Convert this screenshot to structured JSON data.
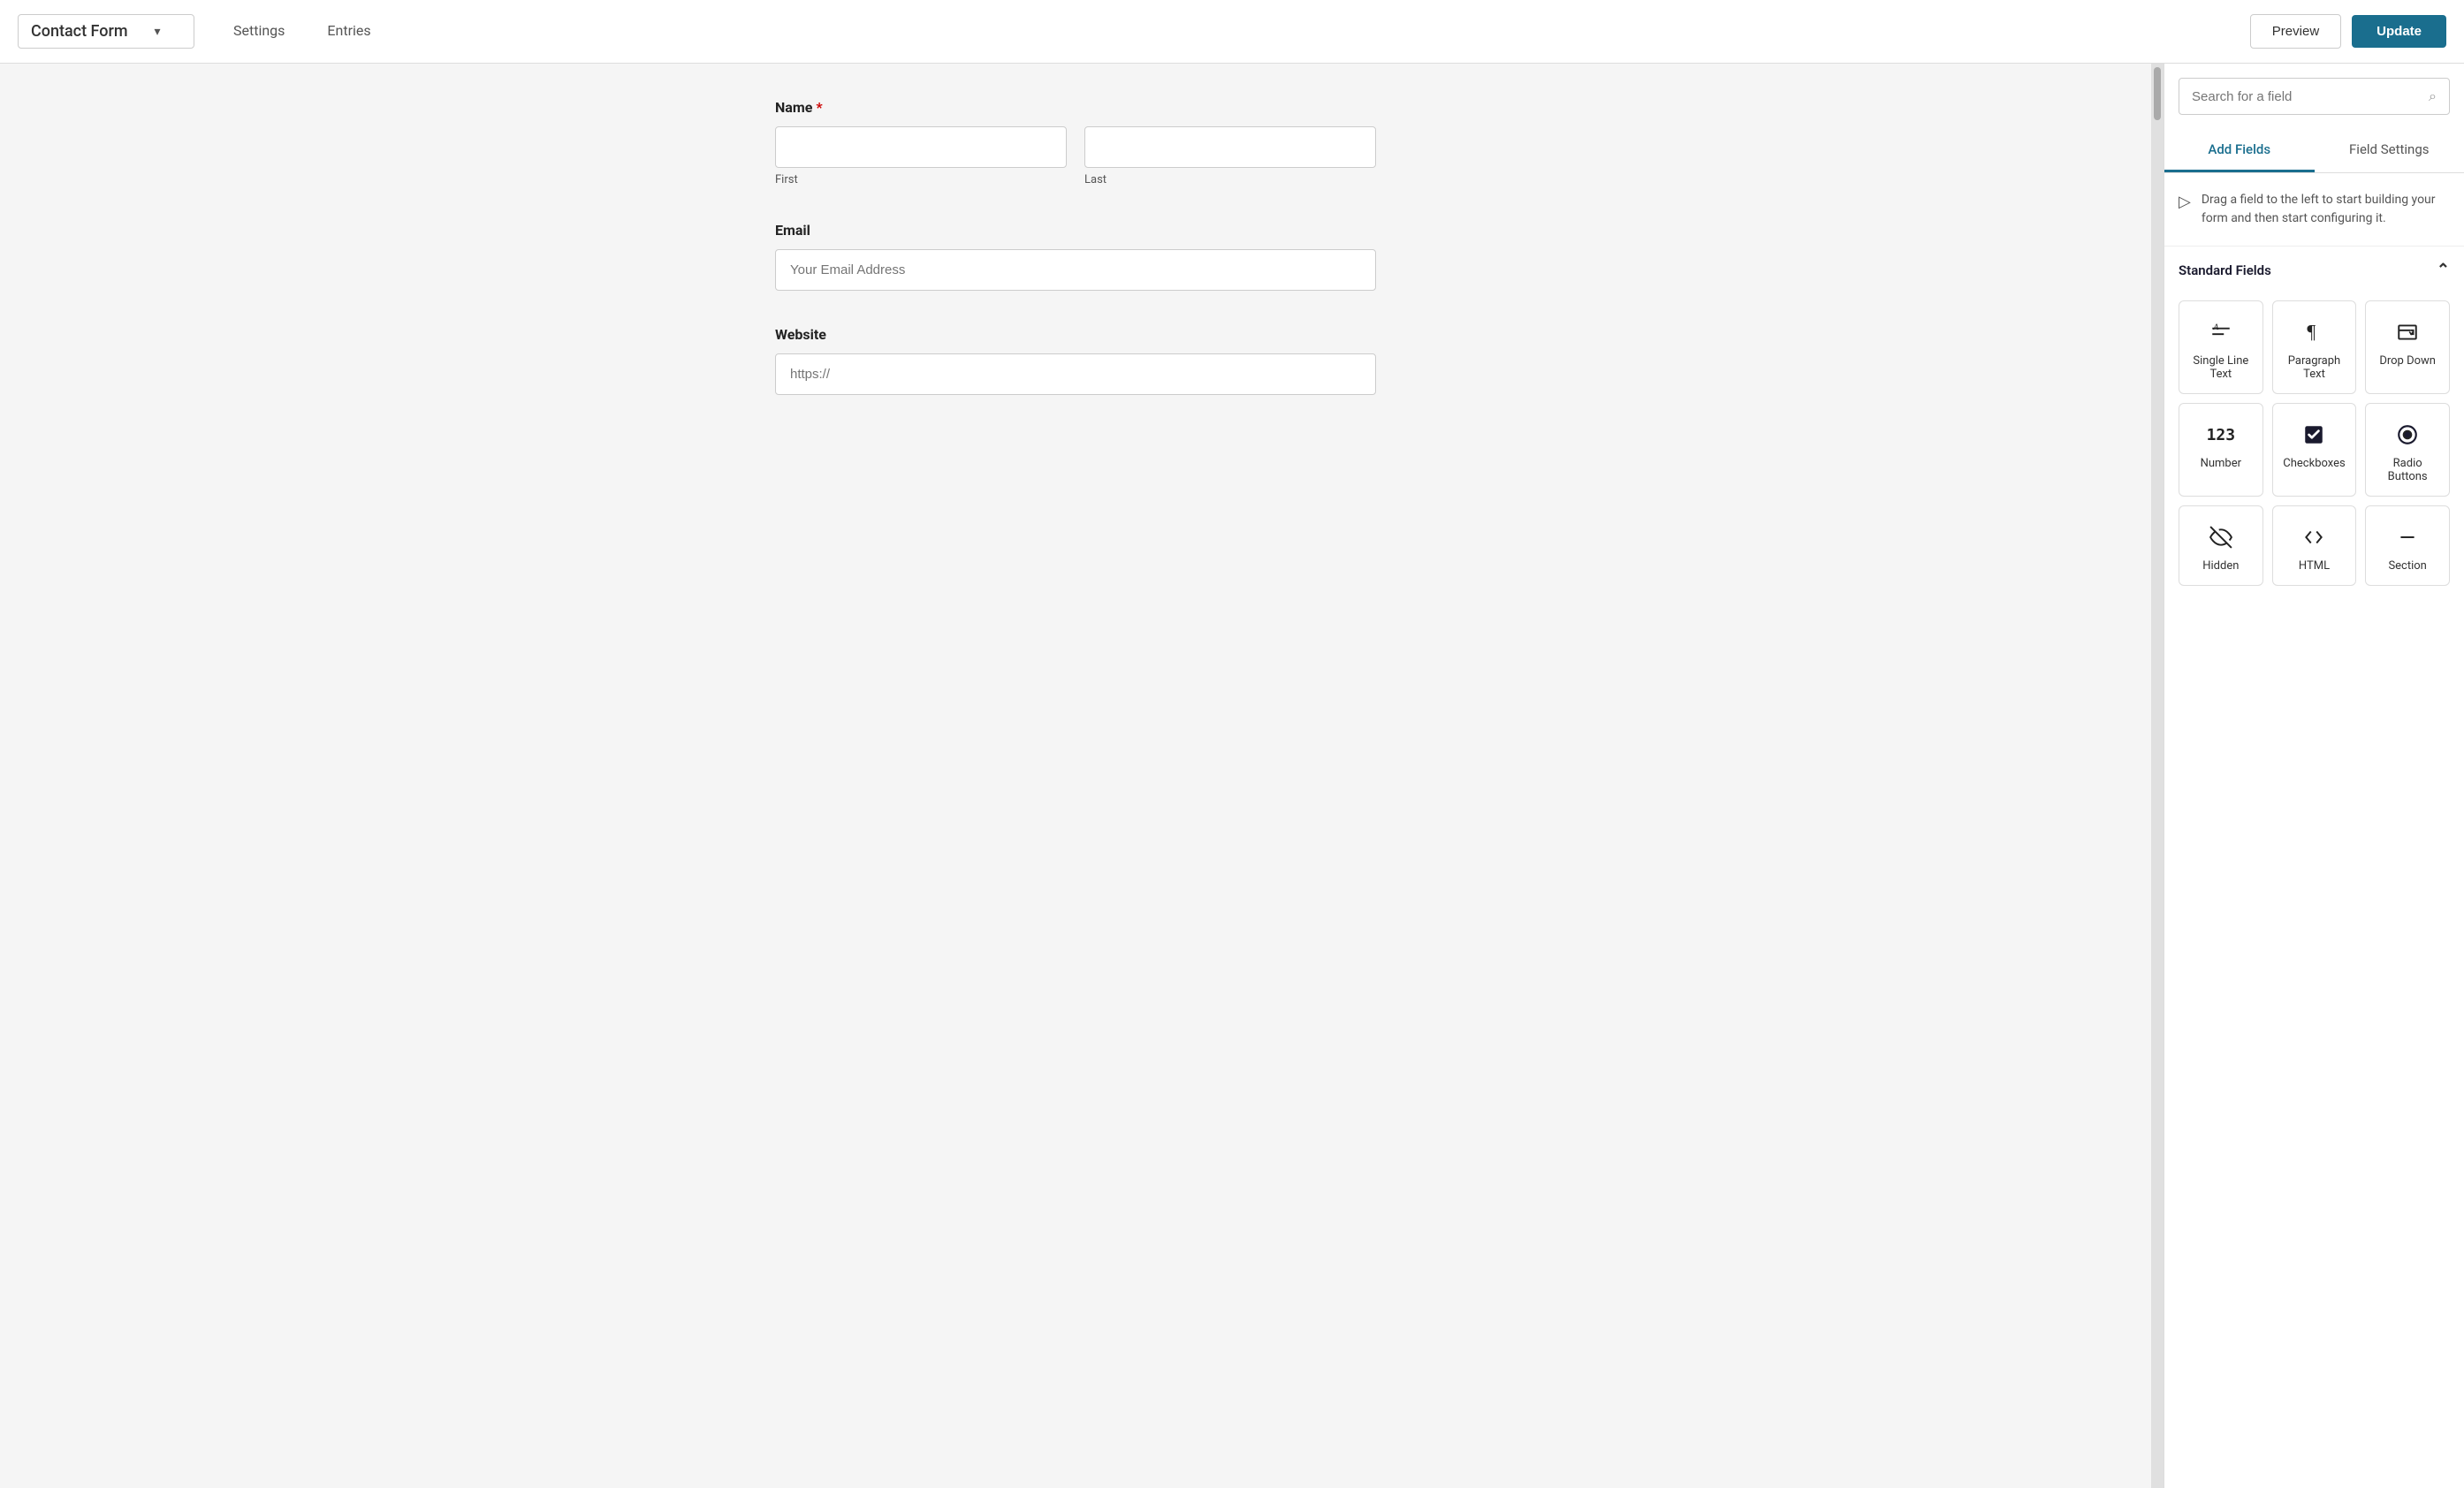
{
  "header": {
    "form_title": "Contact Form",
    "chevron": "▾",
    "nav_items": [
      "Settings",
      "Entries"
    ],
    "preview_label": "Preview",
    "update_label": "Update"
  },
  "form": {
    "fields": [
      {
        "id": "name",
        "label": "Name",
        "required": true,
        "type": "name",
        "sub_fields": [
          {
            "placeholder": "",
            "sub_label": "First"
          },
          {
            "placeholder": "",
            "sub_label": "Last"
          }
        ]
      },
      {
        "id": "email",
        "label": "Email",
        "required": false,
        "type": "single",
        "placeholder": "Your Email Address"
      },
      {
        "id": "website",
        "label": "Website",
        "required": false,
        "type": "single",
        "placeholder": "https://"
      }
    ]
  },
  "right_panel": {
    "search_placeholder": "Search for a field",
    "tabs": [
      "Add Fields",
      "Field Settings"
    ],
    "active_tab": 0,
    "drag_hint": "Drag a field to the left to start building your form and then start configuring it.",
    "standard_fields_label": "Standard Fields",
    "fields": [
      {
        "id": "single-line-text",
        "label": "Single Line Text",
        "icon_type": "text"
      },
      {
        "id": "paragraph-text",
        "label": "Paragraph Text",
        "icon_type": "paragraph"
      },
      {
        "id": "drop-down",
        "label": "Drop Down",
        "icon_type": "dropdown"
      },
      {
        "id": "number",
        "label": "Number",
        "icon_type": "number"
      },
      {
        "id": "checkboxes",
        "label": "Checkboxes",
        "icon_type": "checkbox"
      },
      {
        "id": "radio-buttons",
        "label": "Radio Buttons",
        "icon_type": "radio"
      },
      {
        "id": "hidden",
        "label": "Hidden",
        "icon_type": "hidden"
      },
      {
        "id": "html",
        "label": "HTML",
        "icon_type": "html"
      },
      {
        "id": "section",
        "label": "Section",
        "icon_type": "section"
      }
    ]
  }
}
